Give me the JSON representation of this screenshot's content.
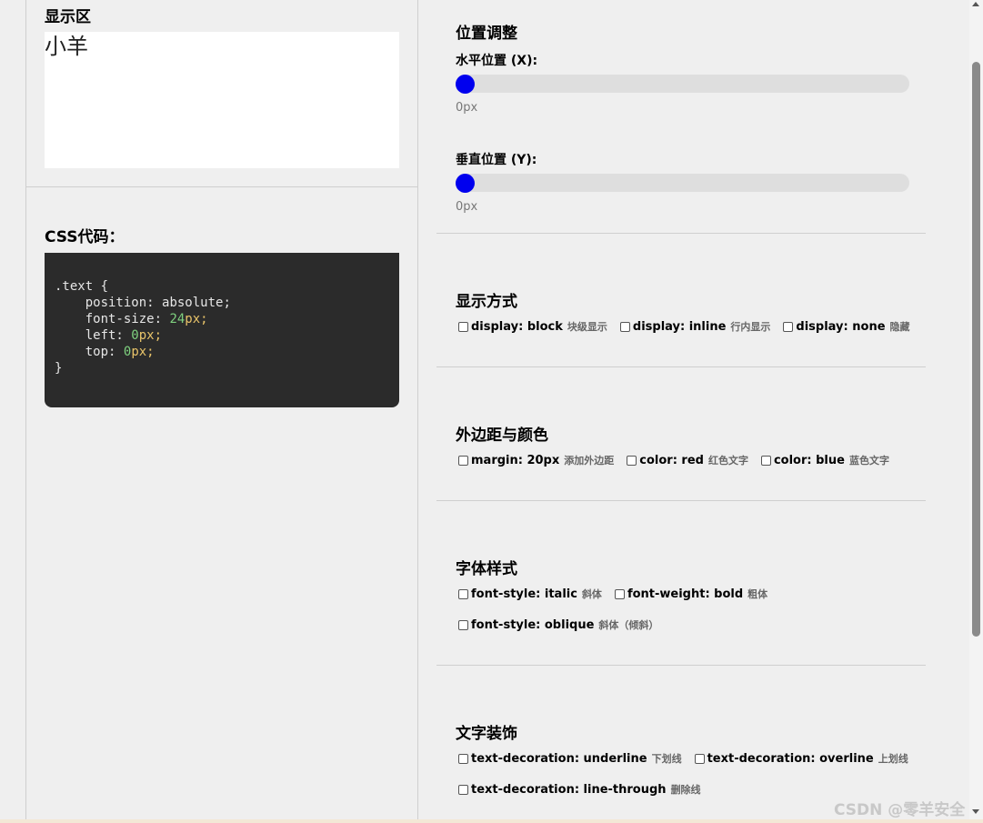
{
  "display": {
    "title": "显示区",
    "text": "小羊"
  },
  "css": {
    "title": "CSS代码：",
    "selector": ".text {",
    "position_prop": "position: ",
    "position_val": "absolute;",
    "font_size_prop": "font-size: ",
    "font_size_num": "24",
    "font_size_unit": "px;",
    "left_prop": "left: ",
    "left_num": "0",
    "left_unit": "px;",
    "top_prop": "top: ",
    "top_num": "0",
    "top_unit": "px;",
    "close": "}"
  },
  "position_section": {
    "title": "位置调整",
    "x_label": "水平位置 (X):",
    "x_value": "0px",
    "x_level": 0,
    "y_label": "垂直位置 (Y):",
    "y_value": "0px",
    "y_level": 0
  },
  "display_section": {
    "title": "显示方式",
    "options": [
      {
        "label": "display: block",
        "hint": "块级显示"
      },
      {
        "label": "display: inline",
        "hint": "行内显示"
      },
      {
        "label": "display: none",
        "hint": "隐藏"
      }
    ]
  },
  "margin_section": {
    "title": "外边距与颜色",
    "options": [
      {
        "label": "margin: 20px",
        "hint": "添加外边距"
      },
      {
        "label": "color: red",
        "hint": "红色文字"
      },
      {
        "label": "color: blue",
        "hint": "蓝色文字"
      }
    ]
  },
  "font_section": {
    "title": "字体样式",
    "options": [
      {
        "label": "font-style: italic",
        "hint": "斜体"
      },
      {
        "label": "font-weight: bold",
        "hint": "粗体"
      },
      {
        "label": "font-style: oblique",
        "hint": "斜体（倾斜）"
      }
    ]
  },
  "decoration_section": {
    "title": "文字装饰",
    "options": [
      {
        "label": "text-decoration: underline",
        "hint": "下划线"
      },
      {
        "label": "text-decoration: overline",
        "hint": "上划线"
      },
      {
        "label": "text-decoration: line-through",
        "hint": "删除线"
      }
    ]
  },
  "watermark": "CSDN @零羊安全",
  "colors": {
    "slider_thumb": "#0000ee",
    "code_bg": "#2b2b2b",
    "number": "#7fd17f",
    "unit": "#e9c46a"
  }
}
